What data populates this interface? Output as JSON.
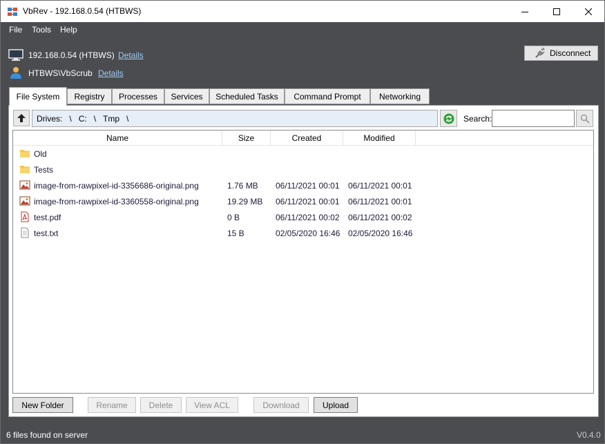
{
  "window": {
    "title": "VbRev - 192.168.0.54 (HTBWS)",
    "icon": "vbrev-app-icon"
  },
  "menu": [
    "File",
    "Tools",
    "Help"
  ],
  "connection": {
    "host": "192.168.0.54 (HTBWS)",
    "host_details_link": "Details",
    "user": "HTBWS\\VbScrub",
    "user_details_link": "Details",
    "disconnect_label": "Disconnect"
  },
  "tabs": [
    "File System",
    "Registry",
    "Processes",
    "Services",
    "Scheduled Tasks",
    "Command Prompt",
    "Networking"
  ],
  "active_tab": "File System",
  "path": {
    "segments": [
      "Drives:",
      "\\",
      "C:",
      "\\",
      "Tmp",
      "\\"
    ]
  },
  "search": {
    "label": "Search:",
    "value": ""
  },
  "columns": [
    "Name",
    "Size",
    "Created",
    "Modified"
  ],
  "files": [
    {
      "name": "Old",
      "size": "",
      "created": "",
      "modified": "",
      "icon": "folder-icon"
    },
    {
      "name": "Tests",
      "size": "",
      "created": "",
      "modified": "",
      "icon": "folder-icon"
    },
    {
      "name": "image-from-rawpixel-id-3356686-original.png",
      "size": "1.76 MB",
      "created": "06/11/2021 00:01",
      "modified": "06/11/2021 00:01",
      "icon": "image-file-icon"
    },
    {
      "name": "image-from-rawpixel-id-3360558-original.png",
      "size": "19.29 MB",
      "created": "06/11/2021 00:01",
      "modified": "06/11/2021 00:01",
      "icon": "image-file-icon"
    },
    {
      "name": "test.pdf",
      "size": "0 B",
      "created": "06/11/2021 00:02",
      "modified": "06/11/2021 00:02",
      "icon": "pdf-file-icon"
    },
    {
      "name": "test.txt",
      "size": "15 B",
      "created": "02/05/2020 16:46",
      "modified": "02/05/2020 16:46",
      "icon": "text-file-icon"
    }
  ],
  "buttons": {
    "new_folder": "New Folder",
    "rename": "Rename",
    "delete": "Delete",
    "view_acl": "View ACL",
    "download": "Download",
    "upload": "Upload"
  },
  "status": {
    "message": "6 files found on server",
    "version": "V0.4.0"
  },
  "colors": {
    "dark_background": "#4a4c50",
    "link": "#9ecbf5",
    "path_background": "#e6eef8",
    "refresh_green": "#2f9e3a",
    "folder_yellow": "#f5c542"
  }
}
